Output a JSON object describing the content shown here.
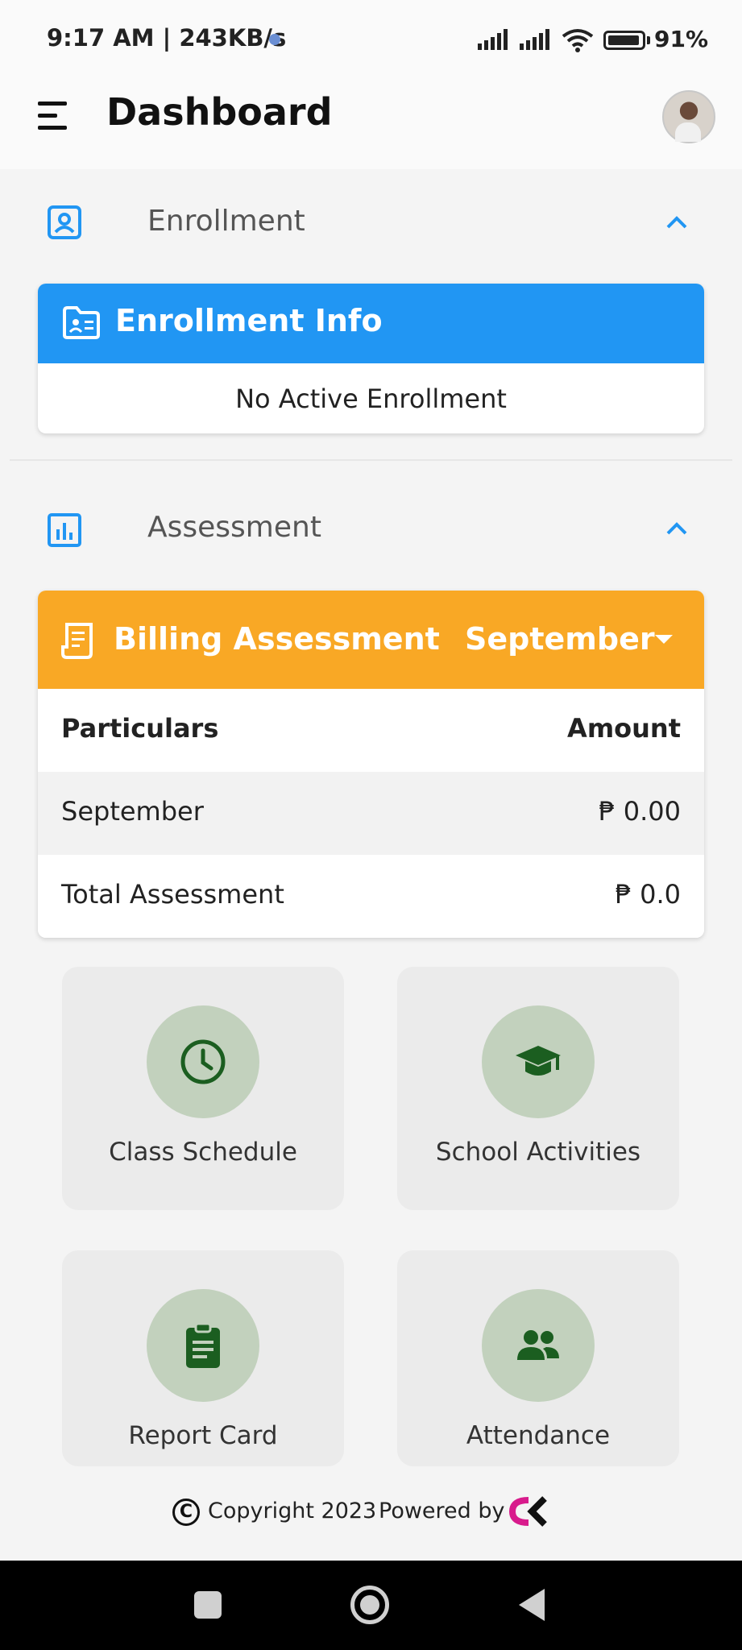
{
  "status_bar": {
    "time": "9:17 AM | 243KB/s",
    "battery": "91%"
  },
  "header": {
    "title": "Dashboard"
  },
  "enrollment": {
    "section_title": "Enrollment",
    "card_title": "Enrollment Info",
    "empty_message": "No Active Enrollment"
  },
  "assessment": {
    "section_title": "Assessment",
    "card_title": "Billing Assessment",
    "selected_month": "September",
    "columns": [
      "Particulars",
      "Amount"
    ],
    "rows": [
      {
        "particular": "September",
        "amount": "₱ 0.00"
      },
      {
        "particular": "Total Assessment",
        "amount": "₱ 0.0"
      }
    ]
  },
  "tiles": [
    {
      "label": "Class Schedule",
      "icon": "clock-icon"
    },
    {
      "label": "School Activities",
      "icon": "graduation-cap-icon"
    },
    {
      "label": "Report Card",
      "icon": "clipboard-icon"
    },
    {
      "label": "Attendance",
      "icon": "people-icon"
    }
  ],
  "footer": {
    "copyright": "Copyright 2023",
    "powered_by": "Powered by"
  },
  "colors": {
    "enrollment_accent": "#2196f3",
    "billing_accent": "#f9a825",
    "tile_icon": "#1b5e20",
    "tile_circle": "#c2d1bd"
  }
}
